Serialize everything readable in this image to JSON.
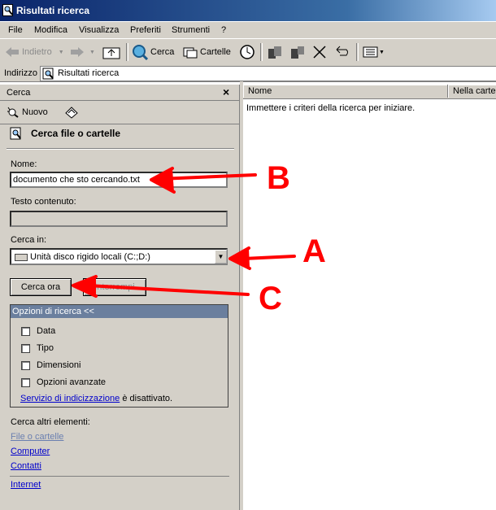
{
  "window": {
    "title": "Risultati ricerca"
  },
  "menu": [
    "File",
    "Modifica",
    "Visualizza",
    "Preferiti",
    "Strumenti",
    "?"
  ],
  "toolbar": {
    "back_label": "Indietro",
    "search_label": "Cerca",
    "folders_label": "Cartelle",
    "icons": [
      "back-arrow-icon",
      "forward-arrow-icon",
      "folder-up-icon",
      "search-icon",
      "folders-icon",
      "history-icon",
      "move-to-icon",
      "copy-to-icon",
      "delete-icon",
      "undo-icon",
      "views-icon"
    ]
  },
  "address": {
    "label": "Indirizzo",
    "value": "Risultati ricerca"
  },
  "search_pane": {
    "title": "Cerca",
    "new_label": "Nuovo",
    "heading": "Cerca file o cartelle",
    "name_label": "Nome:",
    "name_value": "documento che sto cercando.txt",
    "text_label": "Testo contenuto:",
    "text_value": "",
    "look_in_label": "Cerca in:",
    "look_in_value": "Unità disco rigido locali (C:;D:)",
    "search_now_label": "Cerca ora",
    "stop_label": "Interrompi",
    "options_title": "Opzioni di ricerca <<",
    "options": [
      {
        "label": "Data",
        "checked": false
      },
      {
        "label": "Tipo",
        "checked": false
      },
      {
        "label": "Dimensioni",
        "checked": false
      },
      {
        "label": "Opzioni avanzate",
        "checked": false
      }
    ],
    "indexing_link": "Servizio di indicizzazione",
    "indexing_status": " è disattivato.",
    "other_items_label": "Cerca altri elementi:",
    "links": [
      "File o cartelle",
      "Computer",
      "Contatti",
      "Internet"
    ]
  },
  "results": {
    "columns": [
      "Nome",
      "Nella cartella"
    ],
    "message": "Immettere i criteri della ricerca per iniziare."
  },
  "annotations": {
    "a": "A",
    "b": "B",
    "c": "C",
    "color": "#ff0000"
  }
}
